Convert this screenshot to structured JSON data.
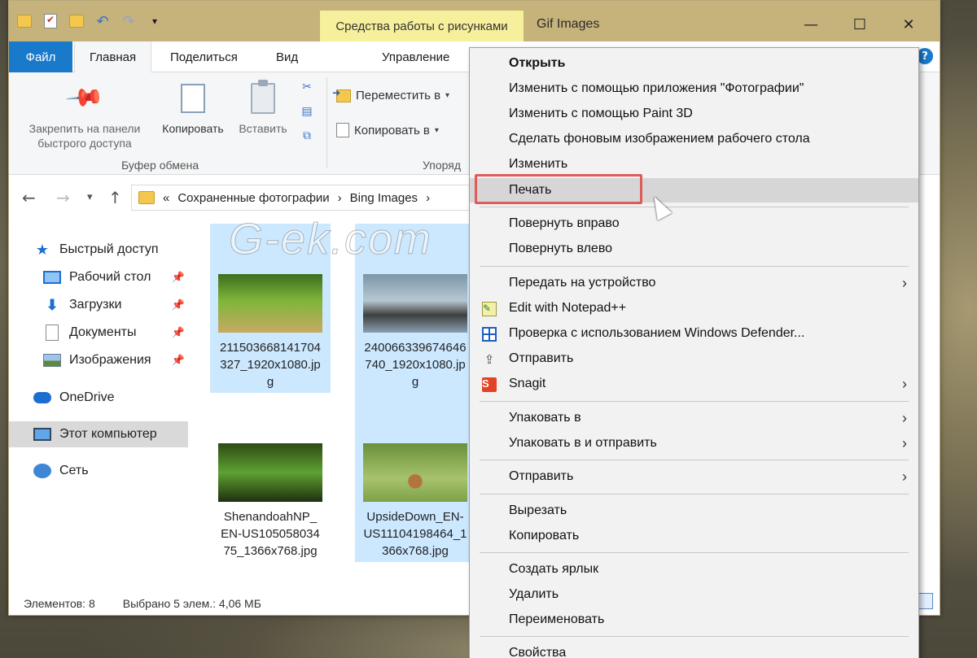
{
  "titlebar": {
    "context_tab": "Средства работы с рисунками",
    "title": "Gif Images",
    "minimize": "—",
    "maximize": "☐",
    "close": "✕"
  },
  "tabs": {
    "file": "Файл",
    "home": "Главная",
    "share": "Поделиться",
    "view": "Вид",
    "manage": "Управление",
    "help": "?"
  },
  "ribbon": {
    "pin_label_1": "Закрепить на панели",
    "pin_label_2": "быстрого доступа",
    "copy": "Копировать",
    "paste": "Вставить",
    "clipboard_group": "Буфер обмена",
    "move_to": "Переместить в",
    "copy_to": "Копировать в",
    "organize_group": "Упоряд"
  },
  "address": {
    "prefix": "«",
    "crumb1": "Сохраненные фотографии",
    "sep": "›",
    "crumb2": "Bing Images",
    "crumb_sep2": "›"
  },
  "navpane": {
    "quick_access": "Быстрый доступ",
    "desktop": "Рабочий стол",
    "downloads": "Загрузки",
    "documents": "Документы",
    "images": "Изображения",
    "onedrive": "OneDrive",
    "this_pc": "Этот компьютер",
    "network": "Сеть"
  },
  "files": [
    {
      "line1": "211503668141704",
      "line2": "327_1920x1080.jp",
      "line3": "g"
    },
    {
      "line1": "240066339674646",
      "line2": "740_1920x1080.jp",
      "line3": "g"
    },
    {
      "line1": "ShenandoahNP_",
      "line2": "EN-US105058034",
      "line3": "75_1366x768.jpg"
    },
    {
      "line1": "UpsideDown_EN-",
      "line2": "US11104198464_1",
      "line3": "366x768.jpg"
    }
  ],
  "watermark": "G-ek.com",
  "status": {
    "items": "Элементов: 8",
    "selected": "Выбрано 5 элем.: 4,06 МБ"
  },
  "context_menu": {
    "open": "Открыть",
    "edit_photos": "Изменить с помощью приложения \"Фотографии\"",
    "edit_paint3d": "Изменить с помощью Paint 3D",
    "set_wallpaper": "Сделать фоновым изображением рабочего стола",
    "edit": "Изменить",
    "print": "Печать",
    "rotate_right": "Повернуть вправо",
    "rotate_left": "Повернуть влево",
    "cast": "Передать на устройство",
    "notepad": "Edit with Notepad++",
    "defender": "Проверка с использованием Windows Defender...",
    "share": "Отправить",
    "snagit": "Snagit",
    "pack": "Упаковать в",
    "pack_send": "Упаковать в и отправить",
    "send_to": "Отправить",
    "cut": "Вырезать",
    "copy": "Копировать",
    "shortcut": "Создать ярлык",
    "delete": "Удалить",
    "rename": "Переименовать",
    "properties": "Свойства"
  }
}
